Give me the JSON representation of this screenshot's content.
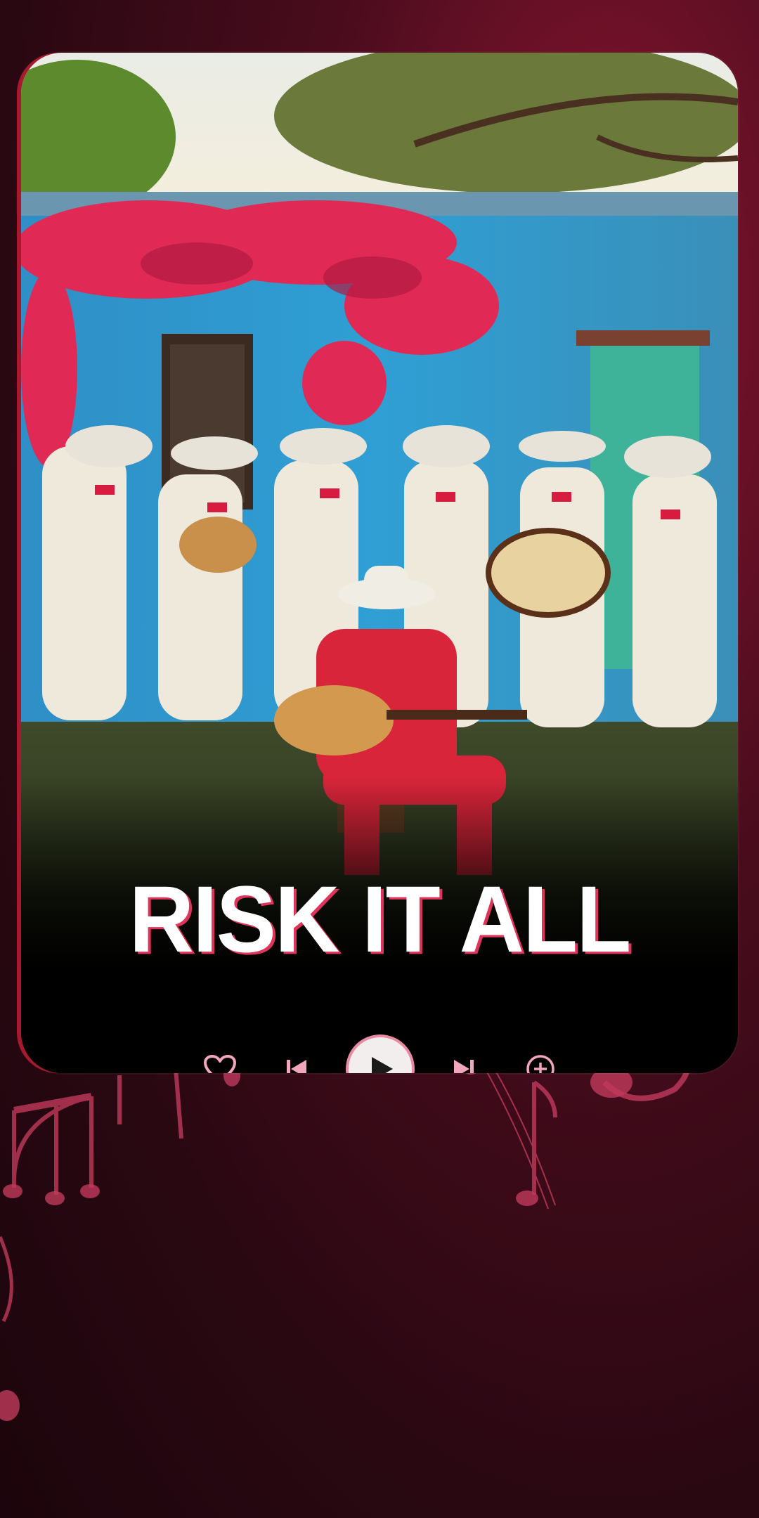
{
  "song": {
    "title": "RISK IT ALL"
  },
  "controls": {
    "like": "heart-icon",
    "previous": "skip-previous-icon",
    "play": "play-icon",
    "next": "skip-next-icon",
    "add": "add-circle-icon"
  },
  "colors": {
    "accent": "#e0335a",
    "background": "#4a0c1d",
    "control": "#f2a6bb"
  }
}
